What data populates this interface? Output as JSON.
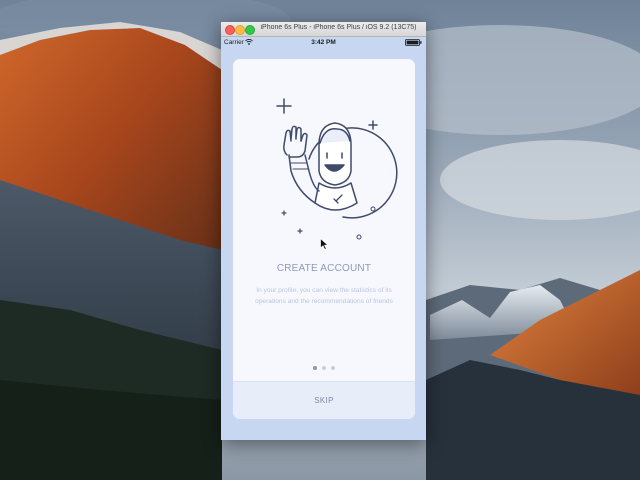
{
  "desktop": {
    "wallpaper": "El Capitan mountain landscape"
  },
  "window": {
    "title": "iPhone 6s Plus - iPhone 6s Plus / iOS 9.2 (13C75)"
  },
  "status_bar": {
    "carrier": "Carrier",
    "time": "3:42 PM"
  },
  "onboarding": {
    "illustration": "astronaut-waving-icon",
    "title": "CREATE ACCOUNT",
    "description": "In your profile, you can view the statistics of its operations and the recommendations of friends",
    "page_count": 3,
    "active_page": 1,
    "skip_label": "SKIP"
  },
  "colors": {
    "window_background": "#c7d7f1",
    "card_background": "#f6f8fd",
    "title_color": "#8e99bd",
    "description_color": "#bcc4dc",
    "skip_background": "#e8eef9",
    "line_art": "#3f4a6b"
  }
}
